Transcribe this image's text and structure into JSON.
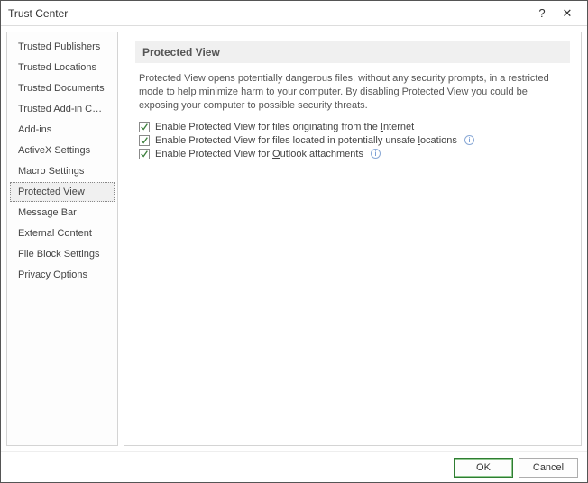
{
  "window": {
    "title": "Trust Center",
    "help": "?",
    "close": "✕"
  },
  "sidebar": {
    "items": [
      "Trusted Publishers",
      "Trusted Locations",
      "Trusted Documents",
      "Trusted Add-in Catalogs",
      "Add-ins",
      "ActiveX Settings",
      "Macro Settings",
      "Protected View",
      "Message Bar",
      "External Content",
      "File Block Settings",
      "Privacy Options"
    ],
    "selectedIndex": 7
  },
  "content": {
    "header": "Protected View",
    "description": "Protected View opens potentially dangerous files, without any security prompts, in a restricted mode to help minimize harm to your computer. By disabling Protected View you could be exposing your computer to possible security threats.",
    "options": [
      {
        "pre": "Enable Protected View for files originating from the ",
        "accel": "I",
        "post": "nternet",
        "info": false
      },
      {
        "pre": "Enable Protected View for files located in potentially unsafe ",
        "accel": "l",
        "post": "ocations",
        "info": true
      },
      {
        "pre": "Enable Protected View for ",
        "accel": "O",
        "post": "utlook attachments",
        "info": true
      }
    ]
  },
  "footer": {
    "ok": "OK",
    "cancel": "Cancel"
  }
}
